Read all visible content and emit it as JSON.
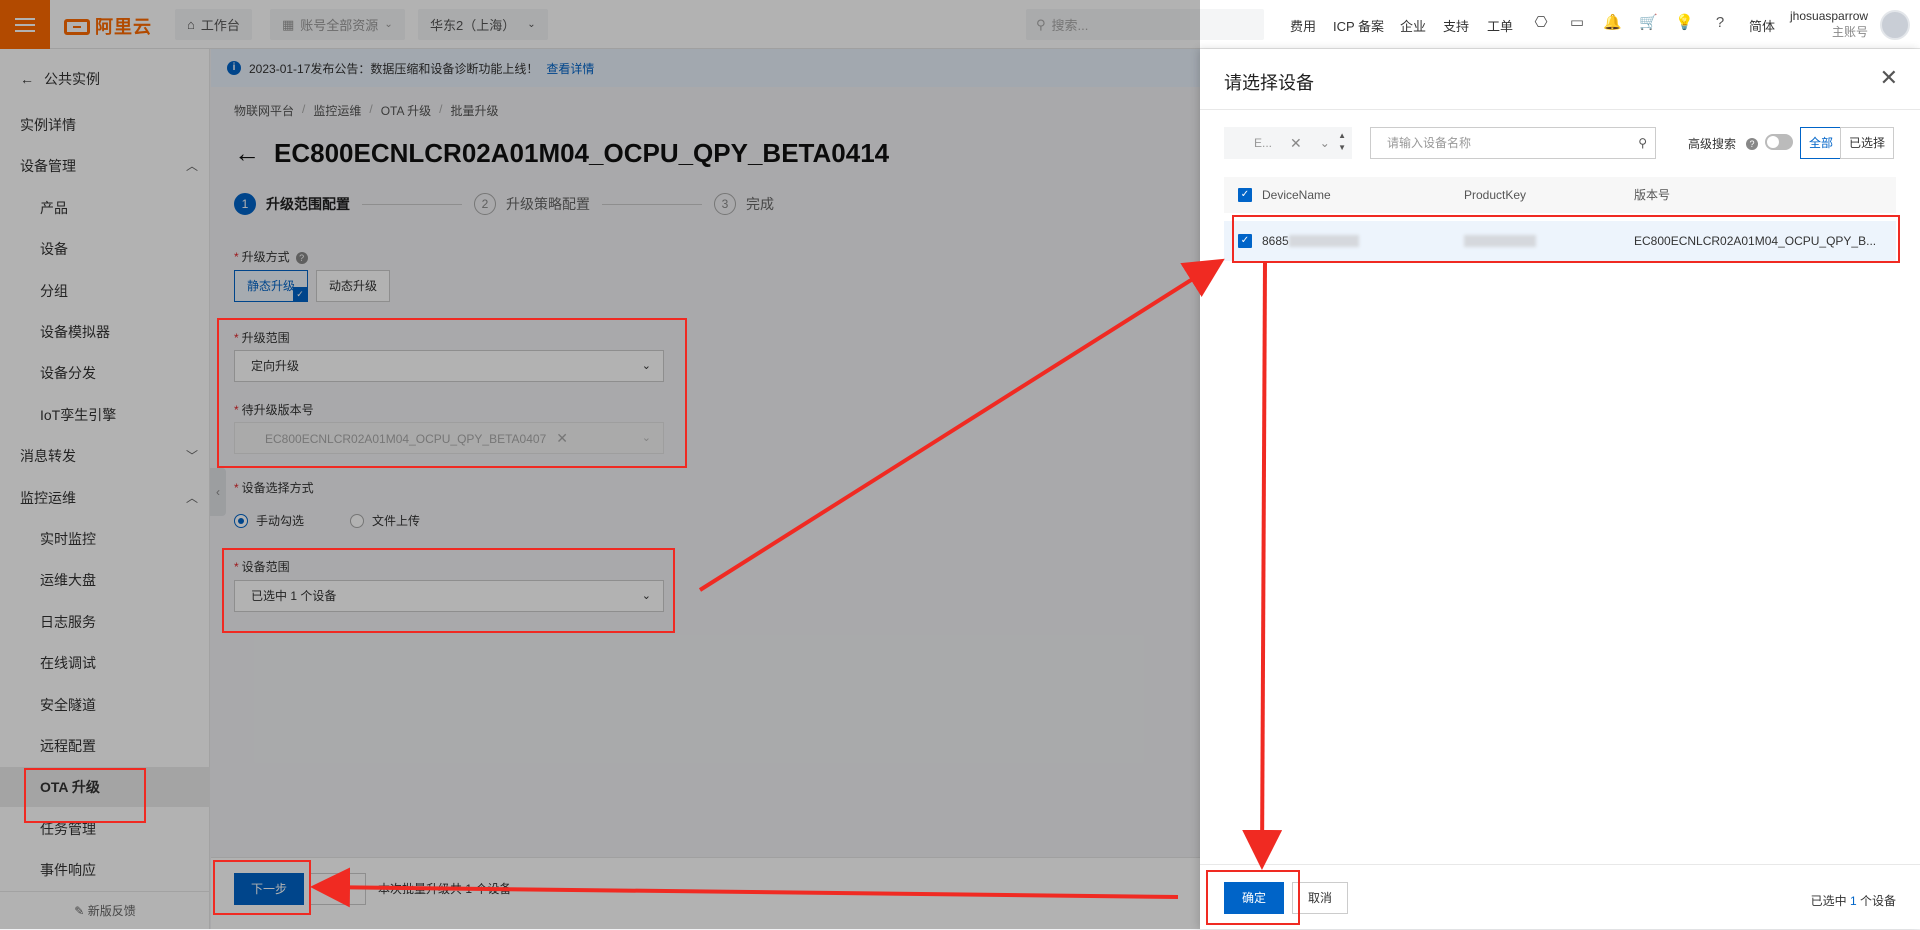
{
  "topbar": {
    "logo": "阿里云",
    "workbench": "工作台",
    "resources": "账号全部资源",
    "region": "华东2（上海）",
    "search_placeholder": "搜索...",
    "links": [
      "费用",
      "ICP 备案",
      "企业",
      "支持",
      "工单"
    ],
    "lang": "简体",
    "user_name": "jhosuasparrow",
    "user_role": "主账号"
  },
  "sidebar": {
    "back": "公共实例",
    "items": [
      {
        "label": "实例详情",
        "level": 1
      },
      {
        "label": "设备管理",
        "level": 1,
        "chevron": "up"
      },
      {
        "label": "产品",
        "level": 2
      },
      {
        "label": "设备",
        "level": 2
      },
      {
        "label": "分组",
        "level": 2
      },
      {
        "label": "设备模拟器",
        "level": 2
      },
      {
        "label": "设备分发",
        "level": 2
      },
      {
        "label": "IoT孪生引擎",
        "level": 2
      },
      {
        "label": "消息转发",
        "level": 1,
        "chevron": "down"
      },
      {
        "label": "监控运维",
        "level": 1,
        "chevron": "up"
      },
      {
        "label": "实时监控",
        "level": 2
      },
      {
        "label": "运维大盘",
        "level": 2
      },
      {
        "label": "日志服务",
        "level": 2
      },
      {
        "label": "在线调试",
        "level": 2
      },
      {
        "label": "安全隧道",
        "level": 2
      },
      {
        "label": "远程配置",
        "level": 2
      },
      {
        "label": "OTA 升级",
        "level": 2,
        "active": true
      },
      {
        "label": "任务管理",
        "level": 2
      },
      {
        "label": "事件响应",
        "level": 2
      }
    ],
    "feedback": "新版反馈"
  },
  "notice": {
    "text": "2023-01-17发布公告：数据压缩和设备诊断功能上线！",
    "link": "查看详情"
  },
  "breadcrumb": [
    "物联网平台",
    "监控运维",
    "OTA 升级",
    "批量升级"
  ],
  "page": {
    "title": "EC800ECNLCR02A01M04_OCPU_QPY_BETA0414",
    "steps": [
      {
        "num": "1",
        "label": "升级范围配置"
      },
      {
        "num": "2",
        "label": "升级策略配置"
      },
      {
        "num": "3",
        "label": "完成"
      }
    ]
  },
  "form": {
    "upgrade_mode_label": "升级方式",
    "upgrade_modes": [
      "静态升级",
      "动态升级"
    ],
    "scope_label": "升级范围",
    "scope_value": "定向升级",
    "version_label": "待升级版本号",
    "version_value": "EC800ECNLCR02A01M04_OCPU_QPY_BETA0407",
    "device_select_label": "设备选择方式",
    "device_select_options": [
      "手动勾选",
      "文件上传"
    ],
    "device_range_label": "设备范围",
    "device_range_value": "已选中 1 个设备"
  },
  "footer": {
    "next": "下一步",
    "cancel": "取消",
    "note": "本次批量升级共 1 个设备"
  },
  "drawer": {
    "title": "请选择设备",
    "filter_value": "E...",
    "search_placeholder": "请输入设备名称",
    "advanced_search": "高级搜索",
    "seg_all": "全部",
    "seg_selected": "已选择",
    "columns": [
      "DeviceName",
      "ProductKey",
      "版本号"
    ],
    "rows": [
      {
        "device_name": "8685",
        "product_key": "",
        "version": "EC800ECNLCR02A01M04_OCPU_QPY_B..."
      }
    ],
    "confirm": "确定",
    "cancel": "取消",
    "selected_prefix": "已选中",
    "selected_count": "1",
    "selected_suffix": "个设备"
  },
  "colors": {
    "brand": "#ff6a00",
    "primary": "#0064c8",
    "annotation": "#f02a22"
  }
}
